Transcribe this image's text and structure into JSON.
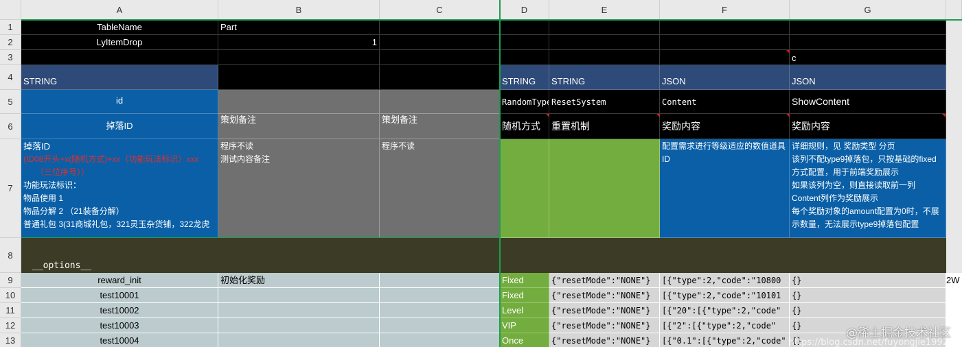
{
  "columns": [
    "A",
    "B",
    "C",
    "D",
    "E",
    "F",
    "G"
  ],
  "rows": [
    "1",
    "2",
    "3",
    "4",
    "5",
    "6",
    "7",
    "8",
    "9",
    "10",
    "11",
    "12",
    "13"
  ],
  "cells": {
    "A1": "TableName",
    "B1": "Part",
    "A2": "LyItemDrop",
    "B2": "1",
    "G3": "c",
    "A4": "STRING",
    "D4": "STRING",
    "E4": "STRING",
    "F4": "JSON",
    "G4": "JSON",
    "A5": "id",
    "D5": "RandomType",
    "E5": "ResetSystem",
    "F5": "Content",
    "G5": "ShowContent",
    "A6": "掉落ID",
    "B6": "策划备注",
    "C6": "策划备注",
    "D6": "随机方式",
    "E6": "重置机制",
    "F6": "奖励内容",
    "G6": "奖励内容",
    "A7_lines": [
      "掉落ID",
      "(ID08开头+x(随机方式)+xx（功能玩法标识）xxx",
      "（三位序号））",
      "功能玩法标识：",
      "物品使用 1",
      "物品分解 2 （21装备分解）",
      "普通礼包 3(31商城礼包，321灵玉杂货铺，322龙虎"
    ],
    "B7_lines": [
      "程序不读",
      "测试内容备注"
    ],
    "C7_lines": [
      "程序不读"
    ],
    "F7_lines": [
      "配置需求进行等级适应的数值道具",
      "ID"
    ],
    "G7_lines": [
      "详细规则，见 奖励类型 分页",
      "该列不配type9掉落包，只按基础的fixed",
      "方式配置，用于前端奖励展示",
      "如果该列为空，则直接读取前一列",
      "Content列作为奖励展示",
      "每个奖励对象的amount配置为0时，不展",
      "示数量，无法展示type9掉落包配置"
    ],
    "A8": "__options__",
    "data_rows": [
      {
        "a": "reward_init",
        "b": "初始化奖励",
        "d": "Fixed",
        "e": "{\"resetMode\":\"NONE\"}",
        "f": "[{\"type\":2,\"code\":\"10800",
        "g": "{}",
        "h": "2W"
      },
      {
        "a": "test10001",
        "b": "",
        "d": "Fixed",
        "e": "{\"resetMode\":\"NONE\"}",
        "f": "[{\"type\":2,\"code\":\"10101",
        "g": "{}",
        "h": ""
      },
      {
        "a": "test10002",
        "b": "",
        "d": "Level",
        "e": "{\"resetMode\":\"NONE\"}",
        "f": "[{\"20\":[{\"type\":2,\"code\"",
        "g": "{}",
        "h": ""
      },
      {
        "a": "test10003",
        "b": "",
        "d": "VIP",
        "e": "{\"resetMode\":\"NONE\"}",
        "f": "[{\"2\":[{\"type\":2,\"code\"",
        "g": "{}",
        "h": ""
      },
      {
        "a": "test10004",
        "b": "",
        "d": "Once",
        "e": "{\"resetMode\":\"NONE\"}",
        "f": "[{\"0.1\":[{\"type\":2,\"code\"",
        "g": "{}",
        "h": ""
      }
    ]
  },
  "watermark": "@稀土掘金技术社区",
  "watermark_url": "https://blog.csdn.net/fuyongjie1992",
  "colors": {
    "header_black": "#000000",
    "type_navy": "#2e4a78",
    "id_blue": "#0a5fa6",
    "note_gray": "#707070",
    "green": "#74ad3f",
    "options_olive": "#3c3c26",
    "data_light": "#bccbcd"
  }
}
